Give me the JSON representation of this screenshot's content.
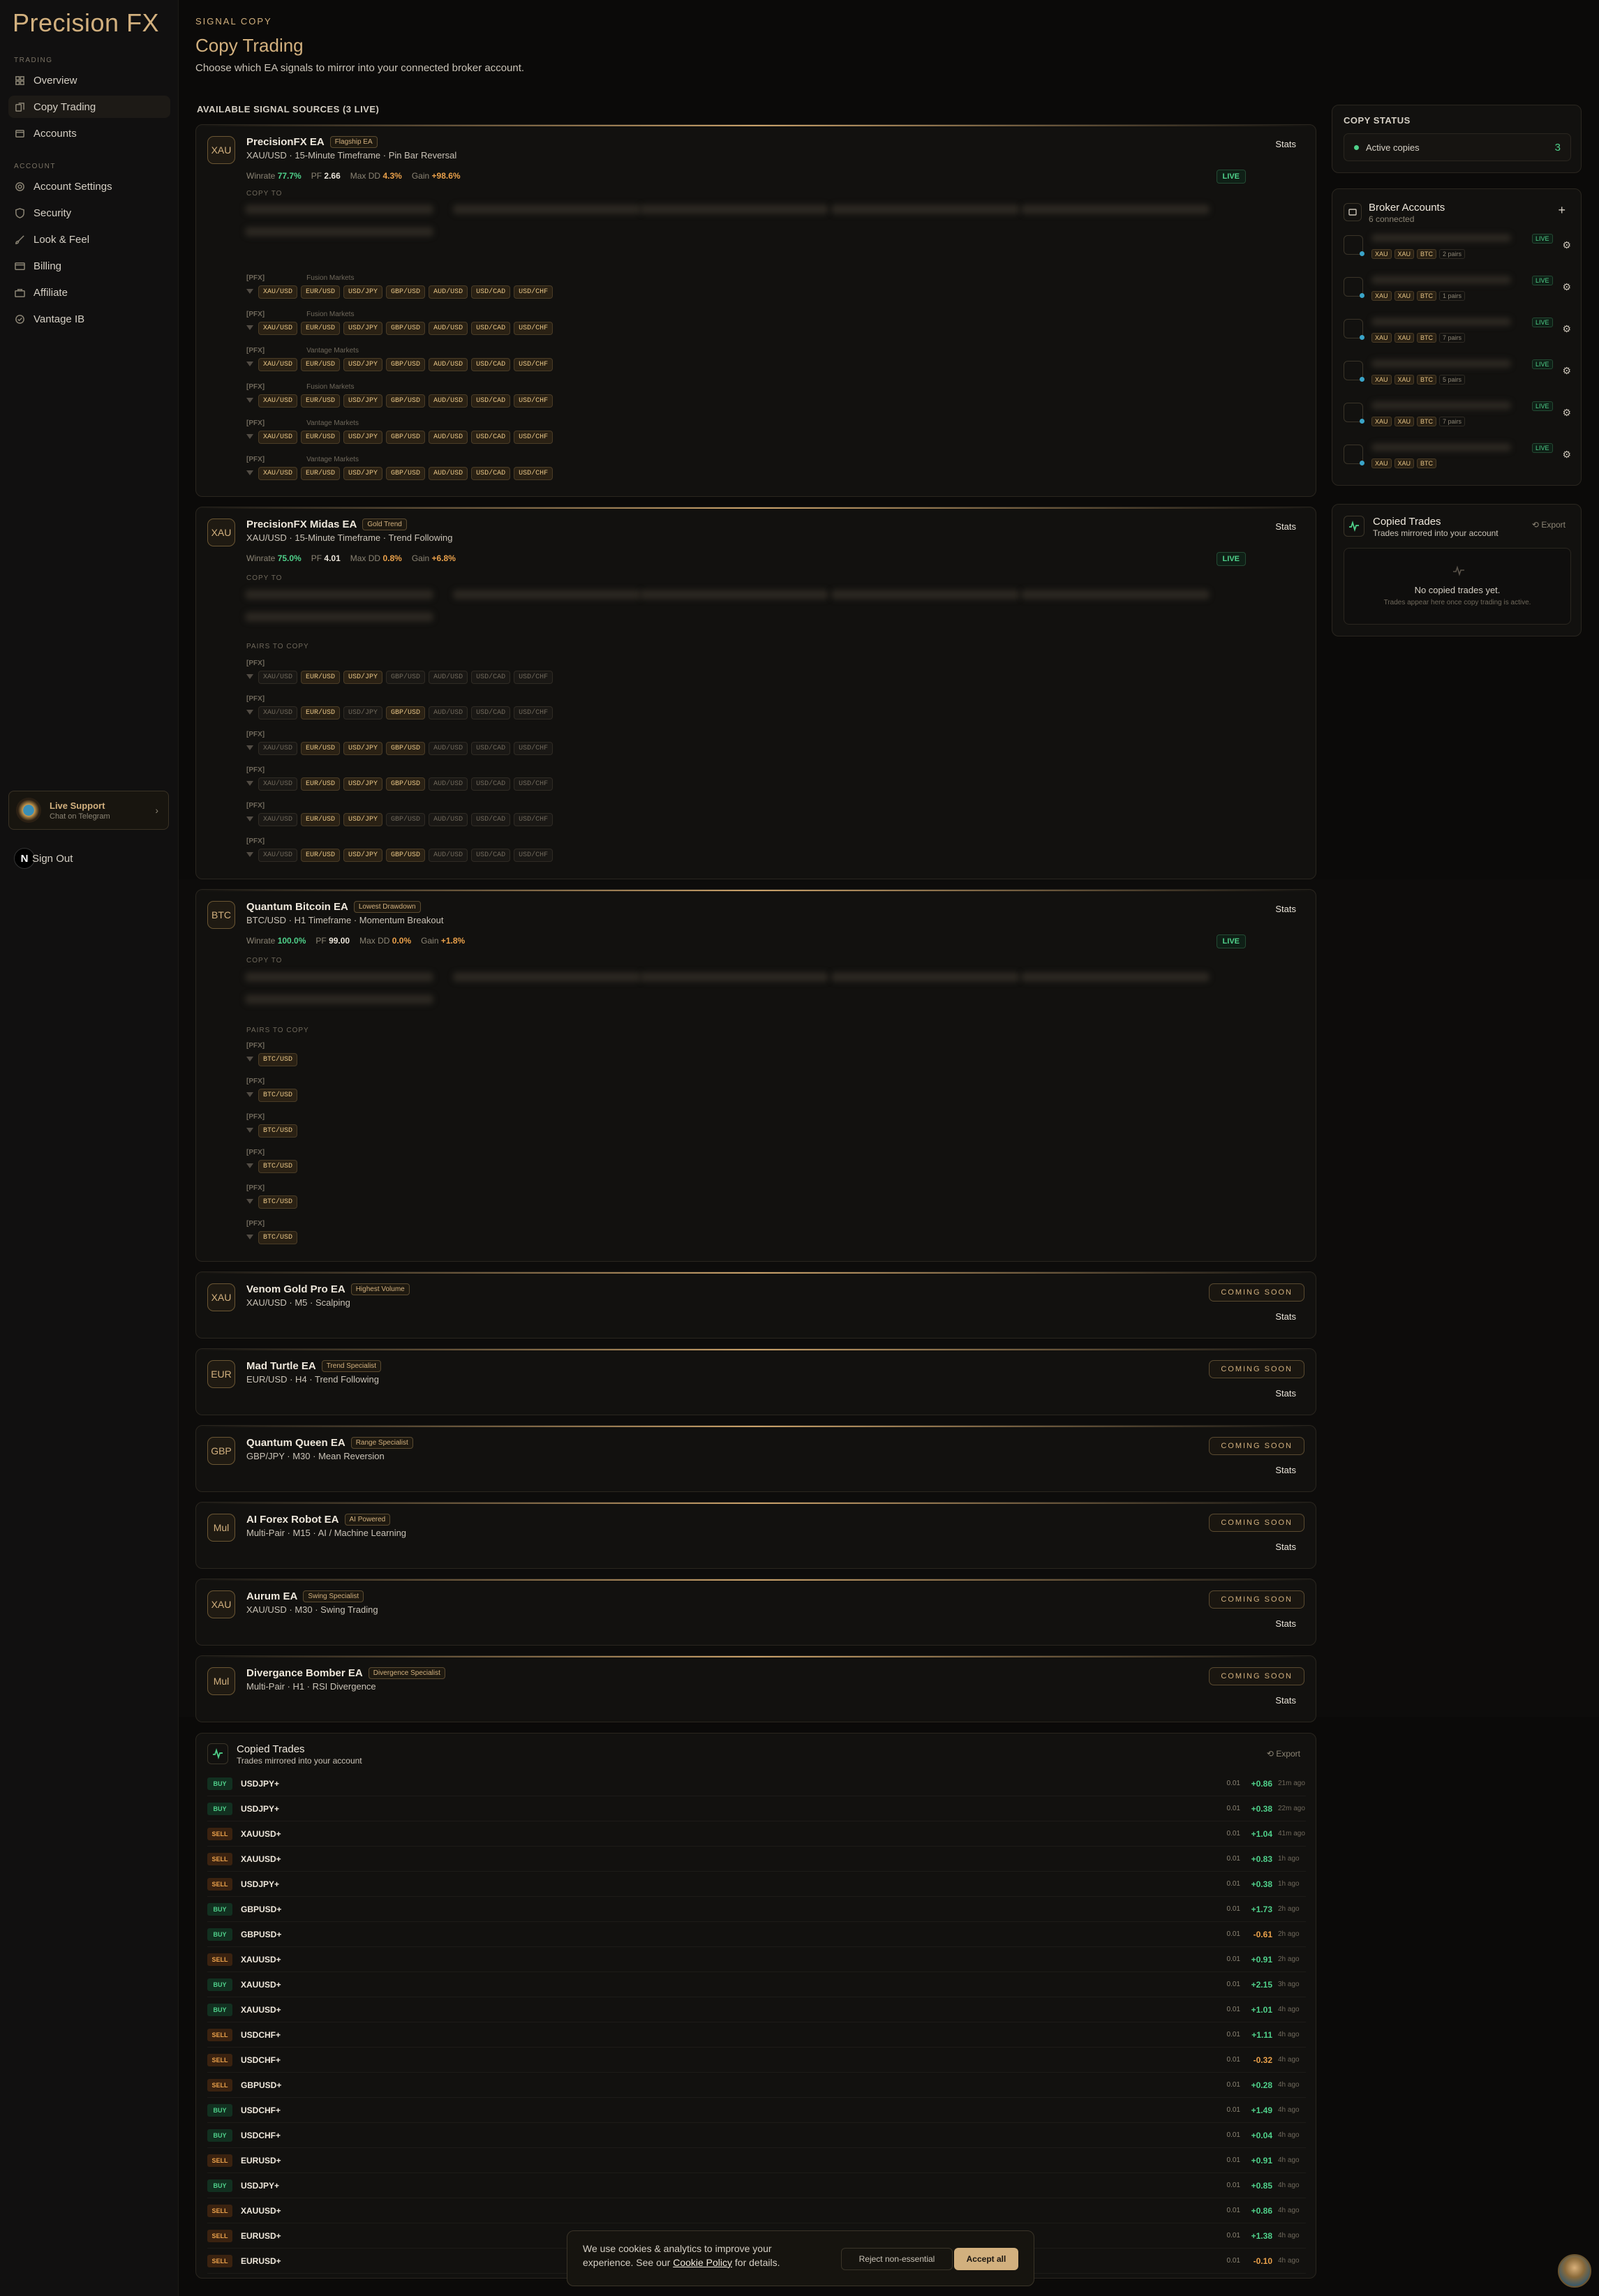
{
  "app": {
    "logo": "Precision FX"
  },
  "sidebar": {
    "section_trading": "TRADING",
    "section_account": "ACCOUNT",
    "items": [
      {
        "label": "Overview",
        "icon": "grid-icon"
      },
      {
        "label": "Copy Trading",
        "icon": "copy-icon"
      },
      {
        "label": "Accounts",
        "icon": "accounts-icon"
      },
      {
        "label": "Account Settings",
        "icon": "gear-icon"
      },
      {
        "label": "Security",
        "icon": "shield-icon"
      },
      {
        "label": "Look & Feel",
        "icon": "brush-icon"
      },
      {
        "label": "Billing",
        "icon": "card-icon"
      },
      {
        "label": "Affiliate",
        "icon": "briefcase-icon"
      },
      {
        "label": "Vantage IB",
        "icon": "check-circle-icon"
      }
    ],
    "support_title": "Live Support",
    "support_sub": "Chat on Telegram",
    "signout": "Sign Out",
    "signout_badge": "N"
  },
  "header": {
    "eyebrow": "SIGNAL COPY",
    "title": "Copy Trading",
    "subtitle": "Choose which EA signals to mirror into your connected broker account."
  },
  "sources_heading": "AVAILABLE SIGNAL SOURCES (3 LIVE)",
  "labels": {
    "copy_to": "COPY TO",
    "pairs_to_copy": "PAIRS TO COPY",
    "stats": "Stats",
    "live": "LIVE",
    "coming_soon": "COMING SOON",
    "pfx": "[PFX]"
  },
  "eas": [
    {
      "symbol": "XAU",
      "name": "PrecisionFX EA",
      "tag": "Flagship EA",
      "sub": "XAU/USD · 15-Minute Timeframe · Pin Bar Reversal",
      "winrate": "77.7%",
      "pf": "2.66",
      "maxdd": "4.3%",
      "gain": "+98.6%"
    },
    {
      "symbol": "XAU",
      "name": "PrecisionFX Midas EA",
      "tag": "Gold Trend",
      "sub": "XAU/USD · 15-Minute Timeframe · Trend Following",
      "winrate": "75.0%",
      "pf": "4.01",
      "maxdd": "0.8%",
      "gain": "+6.8%"
    },
    {
      "symbol": "BTC",
      "name": "Quantum Bitcoin EA",
      "tag": "Lowest Drawdown",
      "sub": "BTC/USD · H1 Timeframe · Momentum Breakout",
      "winrate": "100.0%",
      "pf": "99.00",
      "maxdd": "0.0%",
      "gain": "+1.8%"
    }
  ],
  "stat_labels": {
    "winrate": "Winrate",
    "pf": "PF",
    "maxdd": "Max DD",
    "gain": "Gain"
  },
  "pairs": [
    "XAU/USD",
    "EUR/USD",
    "USD/JPY",
    "GBP/USD",
    "AUD/USD",
    "USD/CAD",
    "USD/CHF"
  ],
  "ea1_accounts": [
    "Fusion Markets",
    "Fusion Markets",
    "Vantage Markets",
    "Fusion Markets",
    "Vantage Markets",
    "Vantage Markets"
  ],
  "btc_pair": "BTC/USD",
  "coming_soon": [
    {
      "symbol": "XAU",
      "name": "Venom Gold Pro EA",
      "tag": "Highest Volume",
      "sub": "XAU/USD · M5 · Scalping"
    },
    {
      "symbol": "EUR",
      "name": "Mad Turtle EA",
      "tag": "Trend Specialist",
      "sub": "EUR/USD · H4 · Trend Following"
    },
    {
      "symbol": "GBP",
      "name": "Quantum Queen EA",
      "tag": "Range Specialist",
      "sub": "GBP/JPY · M30 · Mean Reversion"
    },
    {
      "symbol": "Mul",
      "name": "AI Forex Robot EA",
      "tag": "AI Powered",
      "sub": "Multi-Pair · M15 · AI / Machine Learning"
    },
    {
      "symbol": "XAU",
      "name": "Aurum EA",
      "tag": "Swing Specialist",
      "sub": "XAU/USD · M30 · Swing Trading"
    },
    {
      "symbol": "Mul",
      "name": "Divergance Bomber EA",
      "tag": "Divergence Specialist",
      "sub": "Multi-Pair · H1 · RSI Divergence"
    }
  ],
  "copy_status": {
    "title": "COPY STATUS",
    "label": "Active copies",
    "count": "3"
  },
  "broker": {
    "title": "Broker Accounts",
    "sub": "6 connected",
    "live": "LIVE",
    "accounts": [
      {
        "chips": [
          "XAU",
          "XAU",
          "BTC"
        ],
        "pairs": "2 pairs"
      },
      {
        "chips": [
          "XAU",
          "XAU",
          "BTC"
        ],
        "pairs": "1 pairs"
      },
      {
        "chips": [
          "XAU",
          "XAU",
          "BTC"
        ],
        "pairs": "7 pairs"
      },
      {
        "chips": [
          "XAU",
          "XAU",
          "BTC"
        ],
        "pairs": "5 pairs"
      },
      {
        "chips": [
          "XAU",
          "XAU",
          "BTC"
        ],
        "pairs": "7 pairs"
      },
      {
        "chips": [
          "XAU",
          "XAU",
          "BTC"
        ],
        "pairs": ""
      }
    ]
  },
  "copied_panel": {
    "title": "Copied Trades",
    "sub": "Trades mirrored into your account",
    "export": "Export",
    "empty_title": "No copied trades yet.",
    "empty_sub": "Trades appear here once copy trading is active."
  },
  "copied_trades": {
    "title": "Copied Trades",
    "sub": "Trades mirrored into your account",
    "export": "Export",
    "rows": [
      {
        "side": "BUY",
        "symbol": "USDJPY+",
        "lot": "0.01",
        "pnl": "+0.86",
        "ago": "21m ago"
      },
      {
        "side": "BUY",
        "symbol": "USDJPY+",
        "lot": "0.01",
        "pnl": "+0.38",
        "ago": "22m ago"
      },
      {
        "side": "SELL",
        "symbol": "XAUUSD+",
        "lot": "0.01",
        "pnl": "+1.04",
        "ago": "41m ago"
      },
      {
        "side": "SELL",
        "symbol": "XAUUSD+",
        "lot": "0.01",
        "pnl": "+0.83",
        "ago": "1h ago"
      },
      {
        "side": "SELL",
        "symbol": "USDJPY+",
        "lot": "0.01",
        "pnl": "+0.38",
        "ago": "1h ago"
      },
      {
        "side": "BUY",
        "symbol": "GBPUSD+",
        "lot": "0.01",
        "pnl": "+1.73",
        "ago": "2h ago"
      },
      {
        "side": "BUY",
        "symbol": "GBPUSD+",
        "lot": "0.01",
        "pnl": "-0.61",
        "ago": "2h ago"
      },
      {
        "side": "SELL",
        "symbol": "XAUUSD+",
        "lot": "0.01",
        "pnl": "+0.91",
        "ago": "2h ago"
      },
      {
        "side": "BUY",
        "symbol": "XAUUSD+",
        "lot": "0.01",
        "pnl": "+2.15",
        "ago": "3h ago"
      },
      {
        "side": "BUY",
        "symbol": "XAUUSD+",
        "lot": "0.01",
        "pnl": "+1.01",
        "ago": "4h ago"
      },
      {
        "side": "SELL",
        "symbol": "USDCHF+",
        "lot": "0.01",
        "pnl": "+1.11",
        "ago": "4h ago"
      },
      {
        "side": "SELL",
        "symbol": "USDCHF+",
        "lot": "0.01",
        "pnl": "-0.32",
        "ago": "4h ago"
      },
      {
        "side": "SELL",
        "symbol": "GBPUSD+",
        "lot": "0.01",
        "pnl": "+0.28",
        "ago": "4h ago"
      },
      {
        "side": "BUY",
        "symbol": "USDCHF+",
        "lot": "0.01",
        "pnl": "+1.49",
        "ago": "4h ago"
      },
      {
        "side": "BUY",
        "symbol": "USDCHF+",
        "lot": "0.01",
        "pnl": "+0.04",
        "ago": "4h ago"
      },
      {
        "side": "SELL",
        "symbol": "EURUSD+",
        "lot": "0.01",
        "pnl": "+0.91",
        "ago": "4h ago"
      },
      {
        "side": "BUY",
        "symbol": "USDJPY+",
        "lot": "0.01",
        "pnl": "+0.85",
        "ago": "4h ago"
      },
      {
        "side": "SELL",
        "symbol": "XAUUSD+",
        "lot": "0.01",
        "pnl": "+0.86",
        "ago": "4h ago"
      },
      {
        "side": "SELL",
        "symbol": "EURUSD+",
        "lot": "0.01",
        "pnl": "+1.38",
        "ago": "4h ago"
      },
      {
        "side": "SELL",
        "symbol": "EURUSD+",
        "lot": "0.01",
        "pnl": "-0.10",
        "ago": "4h ago"
      }
    ]
  },
  "cookie": {
    "text_before": "We use cookies & analytics to improve your experience. See our ",
    "link": "Cookie Policy",
    "text_after": " for details.",
    "reject": "Reject non-essential",
    "accept": "Accept all"
  }
}
